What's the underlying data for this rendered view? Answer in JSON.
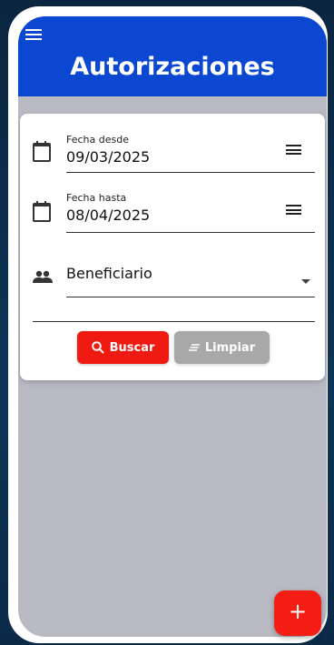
{
  "app": {
    "title": "Autorizaciones",
    "colors": {
      "appbar": "#0b47d1",
      "primary_action": "#ef1a11",
      "secondary_action": "#a8a8a8",
      "fab": "#f41e15"
    }
  },
  "icons": {
    "menu": "menu-icon",
    "calendar": "calendar-icon",
    "equals": "equals-icon",
    "people": "people-icon",
    "dropdown": "dropdown-arrow-icon",
    "search": "search-icon",
    "clear": "clear-icon",
    "add": "plus-icon"
  },
  "filters": {
    "fecha_desde": {
      "label": "Fecha desde",
      "value": "09/03/2025"
    },
    "fecha_hasta": {
      "label": "Fecha hasta",
      "value": "08/04/2025"
    },
    "beneficiario": {
      "value": "Beneficiario"
    }
  },
  "actions": {
    "buscar": "Buscar",
    "limpiar": "Limpiar",
    "fab": "+"
  }
}
